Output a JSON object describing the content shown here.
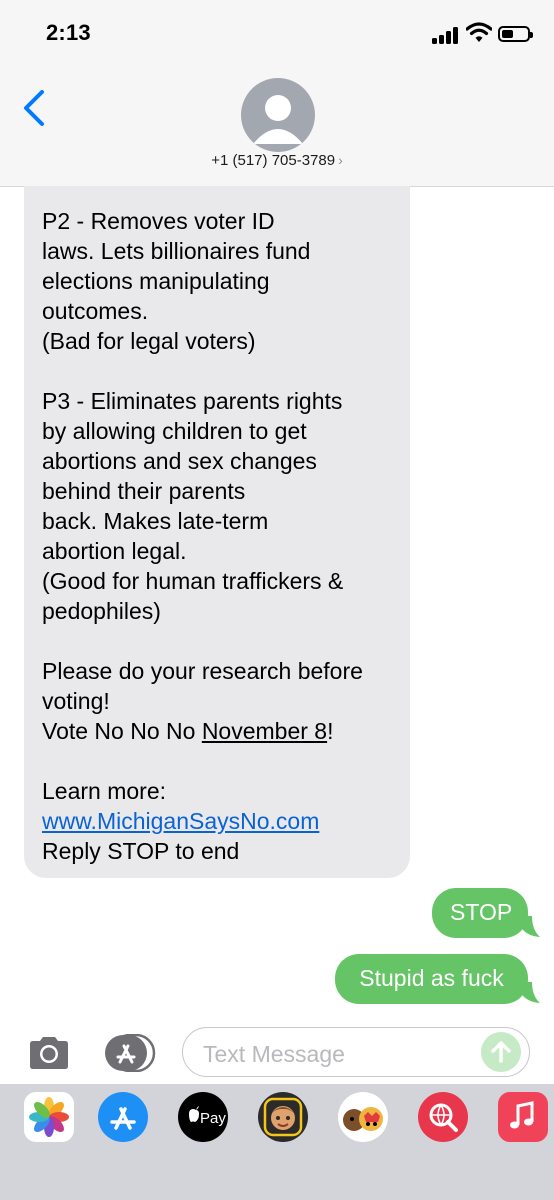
{
  "status_bar": {
    "time": "2:13",
    "battery_level": 0.45
  },
  "header": {
    "contact": "+1 (517) 705-3789",
    "chevron": "›"
  },
  "incoming": {
    "p2": "P2 - Removes voter ID\nlaws. Lets billionaires fund\nelections manipulating\noutcomes.\n(Bad for legal voters)",
    "p3": "P3 - Eliminates parents rights\nby allowing children to get\nabortions and sex changes\nbehind their parents\nback. Makes late-term\nabortion legal.\n(Good for human traffickers &\npedophiles)",
    "research": "Please do your research before\nvoting!",
    "vote_prefix": "Vote No No No ",
    "vote_date": "November 8",
    "vote_suffix": "!",
    "learn_more": "Learn more:",
    "link": "www.MichiganSaysNo.com",
    "reply_stop": "Reply STOP to end"
  },
  "outgoing": [
    {
      "text": "STOP"
    },
    {
      "text": "Stupid as fuck"
    }
  ],
  "input": {
    "placeholder": "Text Message"
  },
  "colors": {
    "incoming_bubble": "#e9e9eb",
    "outgoing_bubble": "#65c466",
    "link": "#0a63d4",
    "accent": "#007aff"
  },
  "app_drawer": [
    "photos-app-icon",
    "app-store-icon",
    "apple-pay-icon",
    "memoji-icon",
    "animoji-icon",
    "web-search-icon",
    "music-icon"
  ],
  "apple_pay_label": "Pay"
}
